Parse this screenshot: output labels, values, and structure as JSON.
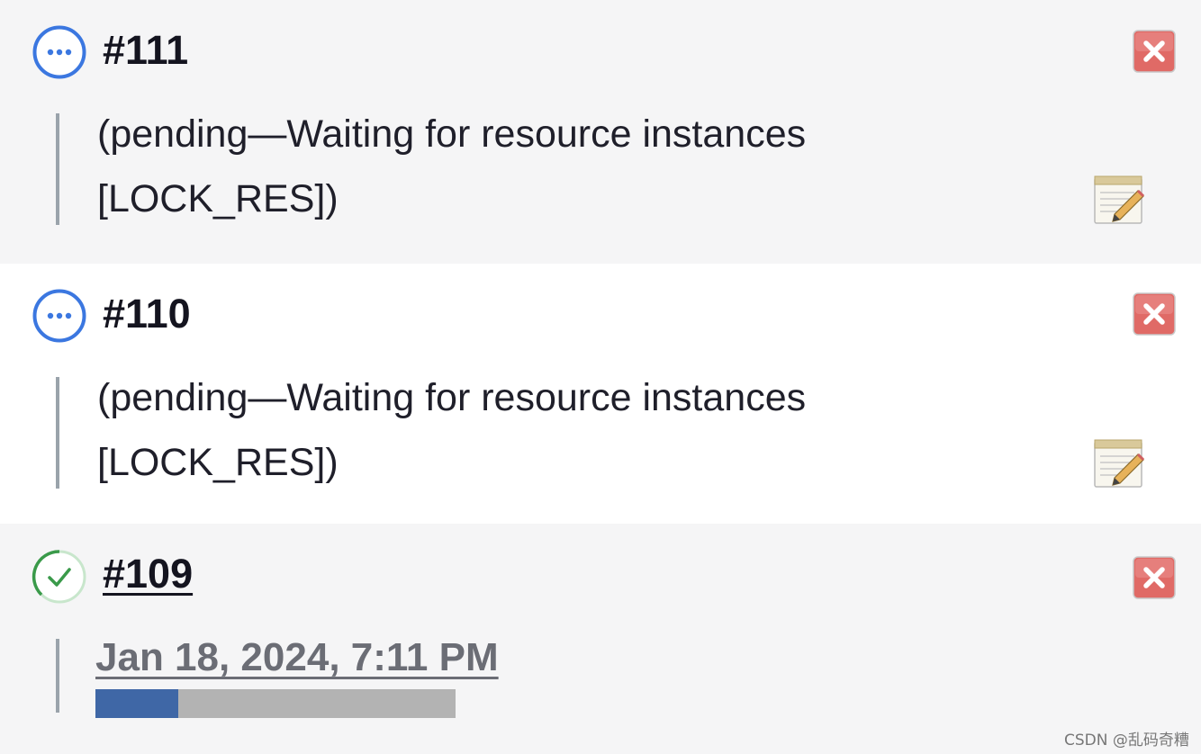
{
  "builds": [
    {
      "number": "#111",
      "status": "pending",
      "status_icon": "in-progress-icon",
      "description_line1": "(pending—Waiting for resource instances",
      "description_line2": "[LOCK_RES])",
      "cancel_icon": "close-icon",
      "edit_icon": "notepad-icon"
    },
    {
      "number": "#110",
      "status": "pending",
      "status_icon": "in-progress-icon",
      "description_line1": "(pending—Waiting for resource instances",
      "description_line2": "[LOCK_RES])",
      "cancel_icon": "close-icon",
      "edit_icon": "notepad-icon"
    },
    {
      "number": "#109",
      "status": "running",
      "status_icon": "running-check-icon",
      "timestamp": "Jan 18, 2024, 7:11 PM",
      "progress": 0.23,
      "cancel_icon": "close-icon"
    }
  ],
  "watermark": "CSDN @乱码奇糟",
  "colors": {
    "pending_blue": "#3b77e0",
    "success_green": "#3a9a4a",
    "cancel_red": "#d9534f",
    "progress_fill": "#3f67a6",
    "progress_track": "#b3b3b3"
  }
}
